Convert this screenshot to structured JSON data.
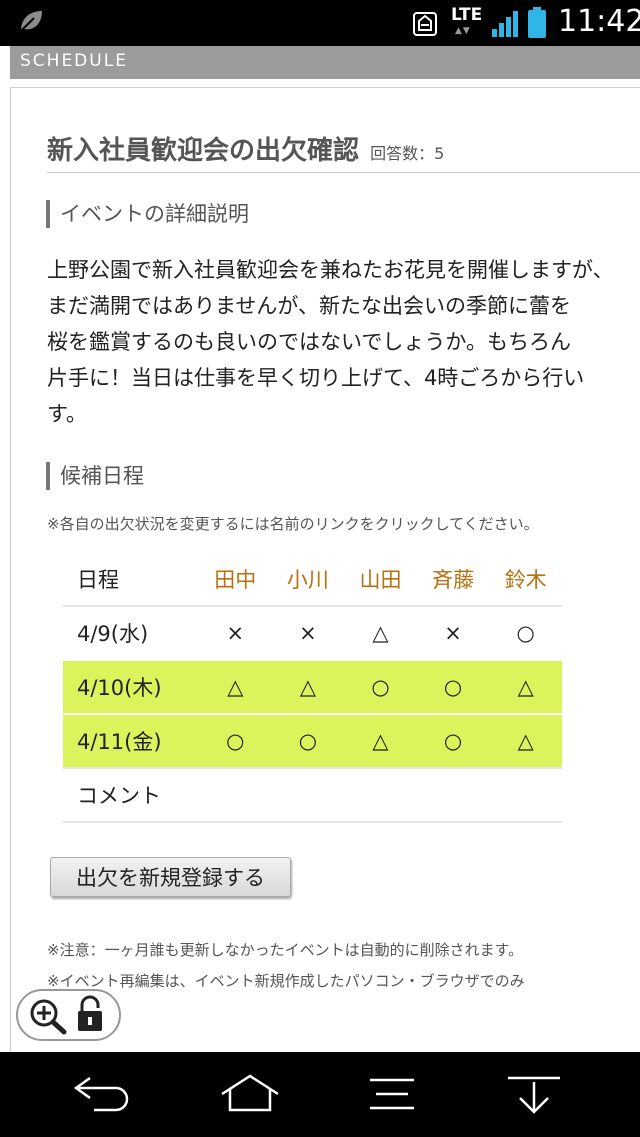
{
  "status_bar": {
    "network_label": "LTE",
    "time": "11:42"
  },
  "header": {
    "label": "SCHEDULE"
  },
  "event": {
    "title": "新入社員歓迎会の出欠確認",
    "answer_count_label": "回答数：5",
    "detail_heading": "イベントの詳細説明",
    "description_lines": [
      "上野公園で新入社員歓迎会を兼ねたお花見を開催しますが、",
      "まだ満開ではありませんが、新たな出会いの季節に蕾を",
      "桜を鑑賞するのも良いのではないでしょうか。もちろん",
      "片手に！当日は仕事を早く切り上げて、4時ごろから行い",
      "す。"
    ]
  },
  "schedule": {
    "heading": "候補日程",
    "note": "※各自の出欠状況を変更するには名前のリンクをクリックしてください。",
    "date_header": "日程",
    "people": [
      "田中",
      "小川",
      "山田",
      "斉藤",
      "鈴木"
    ],
    "rows": [
      {
        "date": "4/9(水)",
        "answers": [
          "×",
          "×",
          "△",
          "×",
          "○"
        ],
        "highlight": false
      },
      {
        "date": "4/10(木)",
        "answers": [
          "△",
          "△",
          "○",
          "○",
          "△"
        ],
        "highlight": true
      },
      {
        "date": "4/11(金)",
        "answers": [
          "○",
          "○",
          "△",
          "○",
          "△"
        ],
        "highlight": true
      }
    ],
    "comment_label": "コメント",
    "highlight_color": "#ddf35c",
    "name_color": "#b5720f"
  },
  "register_button_label": "出欠を新規登録する",
  "footer_notes": [
    "※注意：一ヶ月誰も更新しなかったイベントは自動的に削除されます。",
    "※イベント再編集は、イベント新規作成したパソコン・ブラウザでのみ"
  ],
  "icons": {
    "zoom": "zoom-in-icon",
    "lock": "lock-icon",
    "nav": [
      "back-icon",
      "home-icon",
      "menu-icon",
      "recent-apps-icon"
    ]
  }
}
